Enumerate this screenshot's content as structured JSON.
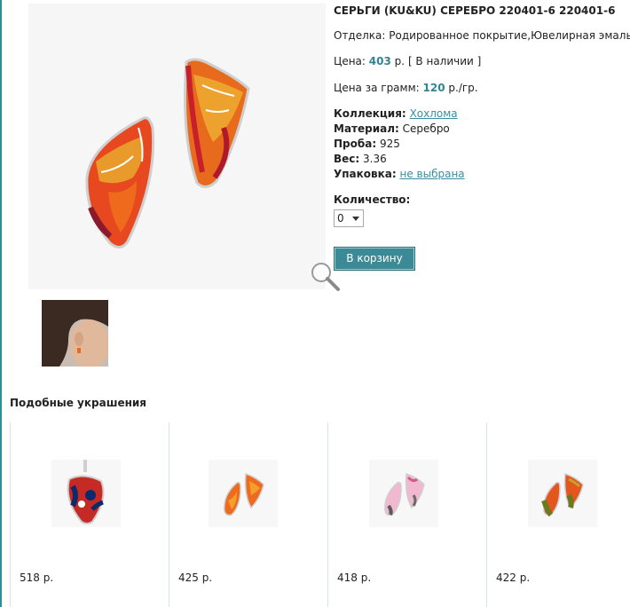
{
  "product": {
    "title": "СЕРЬГИ (KU&KU) СЕРЕБРО 220401-6 220401-6",
    "finish_label": "Отделка:",
    "finish_value": "Родированное покрытие,Ювелирная эмаль",
    "price_label": "Цена:",
    "price_value": "403",
    "price_unit": "р.",
    "availability": "[ В наличии ]",
    "per_gram_label": "Цена за грамм:",
    "per_gram_value": "120",
    "per_gram_unit": "р./гр.",
    "collection_label": "Коллекция:",
    "collection_value": "Хохлома",
    "material_label": "Материал:",
    "material_value": "Серебро",
    "probe_label": "Проба:",
    "probe_value": "925",
    "weight_label": "Вес:",
    "weight_value": "3.36",
    "package_label": "Упаковка:",
    "package_value": "не выбрана",
    "quantity_label": "Количество:",
    "quantity_value": "0",
    "cart_button": "В корзину"
  },
  "similar": {
    "title": "Подобные украшения",
    "items": [
      {
        "price": "518 р.",
        "icon": "pendant-heart-image"
      },
      {
        "price": "425 р.",
        "icon": "earrings-orange-image"
      },
      {
        "price": "418 р.",
        "icon": "earrings-pink-image"
      },
      {
        "price": "422 р.",
        "icon": "earrings-green-image"
      }
    ]
  },
  "colors": {
    "accent": "#3d8a97",
    "price": "#2f8691",
    "link": "#3a8da0"
  }
}
